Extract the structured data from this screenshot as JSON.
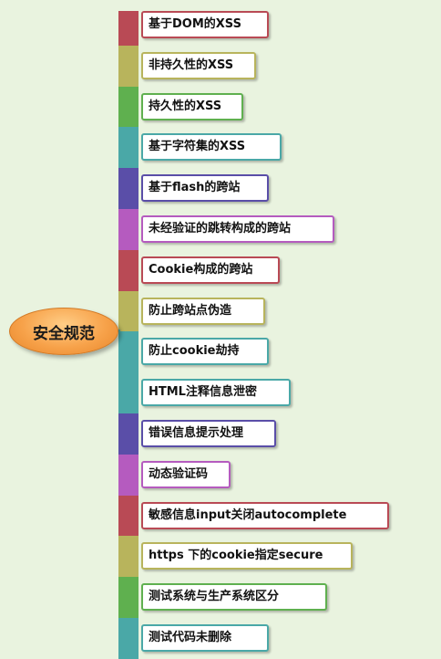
{
  "root": {
    "label": "安全规范"
  },
  "colors": {
    "red": "#b94a55",
    "olive": "#b8b45c",
    "green": "#5fb04f",
    "teal": "#4aa8a7",
    "indigo": "#5a4ea8",
    "magenta": "#b55bbf"
  },
  "items": [
    {
      "label": "基于DOM的XSS",
      "color": "#b94a55"
    },
    {
      "label": "非持久性的XSS",
      "color": "#b8b45c"
    },
    {
      "label": "持久性的XSS",
      "color": "#5fb04f"
    },
    {
      "label": "基于字符集的XSS",
      "color": "#4aa8a7"
    },
    {
      "label": "基于flash的跨站",
      "color": "#5a4ea8"
    },
    {
      "label": "未经验证的跳转构成的跨站",
      "color": "#b55bbf"
    },
    {
      "label": "Cookie构成的跨站",
      "color": "#b94a55"
    },
    {
      "label": "防止跨站点伪造",
      "color": "#b8b45c"
    },
    {
      "label": "防止cookie劫持",
      "color": "#4aa8a7"
    },
    {
      "label": "HTML注释信息泄密",
      "color": "#4aa8a7"
    },
    {
      "label": "错误信息提示处理",
      "color": "#5a4ea8"
    },
    {
      "label": "动态验证码",
      "color": "#b55bbf"
    },
    {
      "label": "敏感信息input关闭autocomplete",
      "color": "#b94a55"
    },
    {
      "label": "https 下的cookie指定secure",
      "color": "#b8b45c"
    },
    {
      "label": "测试系统与生产系统区分",
      "color": "#5fb04f"
    },
    {
      "label": "测试代码未删除",
      "color": "#4aa8a7"
    }
  ]
}
